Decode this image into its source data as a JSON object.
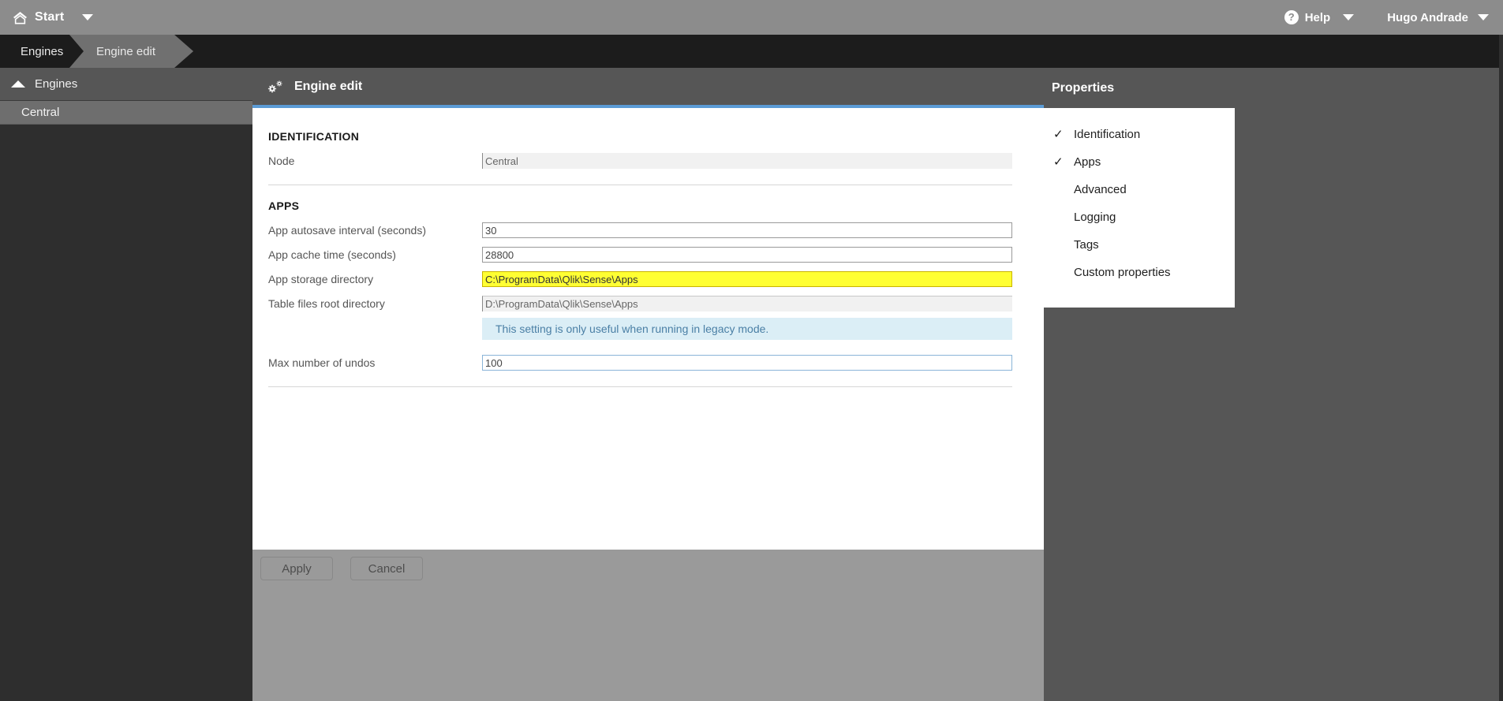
{
  "topbar": {
    "home_icon": "home-icon",
    "start_label": "Start",
    "start_caret": "chevron-down-icon",
    "help_glyph": "?",
    "help_label": "Help",
    "help_caret": "chevron-down-icon",
    "user_label": "Hugo Andrade",
    "user_caret": "chevron-down-icon"
  },
  "breadcrumb": {
    "items": [
      {
        "label": "Engines",
        "active": false
      },
      {
        "label": "Engine edit",
        "active": true
      }
    ]
  },
  "sidebar": {
    "header_label": "Engines",
    "header_icon": "chevron-up-icon",
    "items": [
      {
        "label": "Central",
        "selected": true
      }
    ]
  },
  "panel": {
    "icon": "gear-icon",
    "title": "Engine edit",
    "accent_color": "#5b9bd5"
  },
  "form": {
    "sections": [
      {
        "title": "IDENTIFICATION",
        "fields": [
          {
            "label": "Node",
            "value": "Central",
            "state": "readonly"
          }
        ]
      },
      {
        "title": "APPS",
        "fields": [
          {
            "label": "App autosave interval (seconds)",
            "value": "30",
            "state": "normal"
          },
          {
            "label": "App cache time (seconds)",
            "value": "28800",
            "state": "normal"
          },
          {
            "label": "App storage directory",
            "value": "C:\\ProgramData\\Qlik\\Sense\\Apps",
            "state": "highlight"
          },
          {
            "label": "Table files root directory",
            "value": "D:\\ProgramData\\Qlik\\Sense\\Apps",
            "state": "readonly"
          }
        ],
        "info_message": "This setting is only useful when running in legacy mode.",
        "trailing_fields": [
          {
            "label": "Max number of undos",
            "value": "100",
            "state": "focused"
          }
        ]
      }
    ]
  },
  "footer": {
    "apply_label": "Apply",
    "cancel_label": "Cancel"
  },
  "properties": {
    "title": "Properties",
    "items": [
      {
        "label": "Identification",
        "checked": true
      },
      {
        "label": "Apps",
        "checked": true
      },
      {
        "label": "Advanced",
        "checked": false
      },
      {
        "label": "Logging",
        "checked": false
      },
      {
        "label": "Tags",
        "checked": false
      },
      {
        "label": "Custom properties",
        "checked": false
      }
    ],
    "check_glyph": "✓"
  },
  "colors": {
    "topbar_bg": "#8c8c8c",
    "crumb_bg": "#1c1c1c",
    "crumb_active_bg": "#707070",
    "panel_header_bg": "#565656",
    "accent": "#5b9bd5",
    "highlight_field": "#ffff33",
    "info_bg": "#dbeef6",
    "info_text": "#4a7fa5"
  }
}
